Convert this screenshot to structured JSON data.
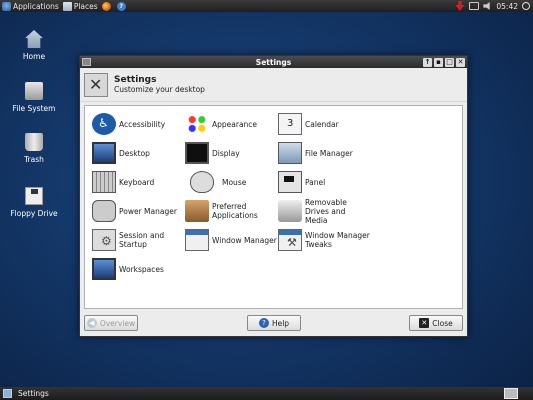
{
  "top_panel": {
    "applications": "Applications",
    "places": "Places",
    "clock": "05:42"
  },
  "desktop_icons": [
    {
      "label": "Home",
      "icon": "home-folder-icon"
    },
    {
      "label": "File System",
      "icon": "drive-icon"
    },
    {
      "label": "Trash",
      "icon": "trash-icon"
    },
    {
      "label": "Floppy Drive",
      "icon": "floppy-icon"
    }
  ],
  "window": {
    "title": "Settings",
    "header_title": "Settings",
    "header_subtitle": "Customize your desktop",
    "items": [
      {
        "label": "Accessibility",
        "icon": "accessibility-icon"
      },
      {
        "label": "Appearance",
        "icon": "appearance-icon"
      },
      {
        "label": "Calendar",
        "icon": "calendar-icon"
      },
      {
        "label": "Desktop",
        "icon": "desktop-icon"
      },
      {
        "label": "Display",
        "icon": "display-icon"
      },
      {
        "label": "File Manager",
        "icon": "file-manager-icon"
      },
      {
        "label": "Keyboard",
        "icon": "keyboard-icon"
      },
      {
        "label": "Mouse",
        "icon": "mouse-icon"
      },
      {
        "label": "Panel",
        "icon": "panel-icon"
      },
      {
        "label": "Power Manager",
        "icon": "power-manager-icon"
      },
      {
        "label": "Preferred Applications",
        "icon": "preferred-apps-icon"
      },
      {
        "label": "Removable Drives and Media",
        "icon": "removable-drives-icon"
      },
      {
        "label": "Session and Startup",
        "icon": "session-icon"
      },
      {
        "label": "Window Manager",
        "icon": "window-manager-icon"
      },
      {
        "label": "Window Manager Tweaks",
        "icon": "wm-tweaks-icon"
      },
      {
        "label": "Workspaces",
        "icon": "workspaces-icon"
      }
    ],
    "buttons": {
      "overview": "Overview",
      "help": "Help",
      "close": "Close"
    }
  },
  "taskbar": {
    "task_label": "Settings"
  }
}
